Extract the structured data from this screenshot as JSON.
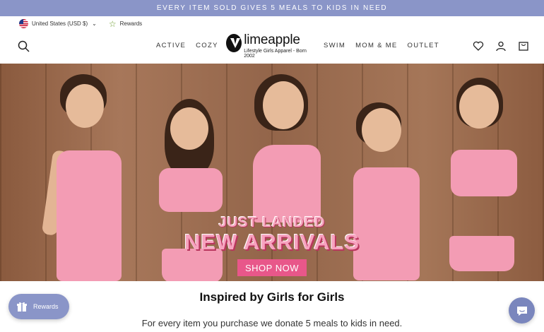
{
  "announcement": {
    "text": "EVERY ITEM SOLD GIVES 5 MEALS TO KIDS IN NEED"
  },
  "utility": {
    "currency": "United States (USD $)",
    "rewards": "Rewards"
  },
  "nav": {
    "left": [
      "ACTIVE",
      "COZY"
    ],
    "right": [
      "SWIM",
      "MOM & ME",
      "OUTLET"
    ]
  },
  "logo": {
    "name": "limeapple",
    "tagline": "Lifestyle Girls Apparel - Born 2002"
  },
  "hero": {
    "kicker": "JUST LANDED",
    "headline": "NEW ARRIVALS",
    "cta": "SHOP NOW"
  },
  "intro": {
    "title": "Inspired by Girls for Girls",
    "text": "For every item you purchase we donate 5 meals to kids in need."
  },
  "widgets": {
    "rewards": "Rewards"
  },
  "icons": [
    "search-icon",
    "heart-icon",
    "user-icon",
    "bag-icon",
    "gift-icon",
    "chat-icon",
    "flag-icon",
    "star-icon"
  ],
  "colors": {
    "announcement_bar": "#8a95c8",
    "cta": "#e8578a",
    "headline_pink": "#f7a3bf"
  }
}
